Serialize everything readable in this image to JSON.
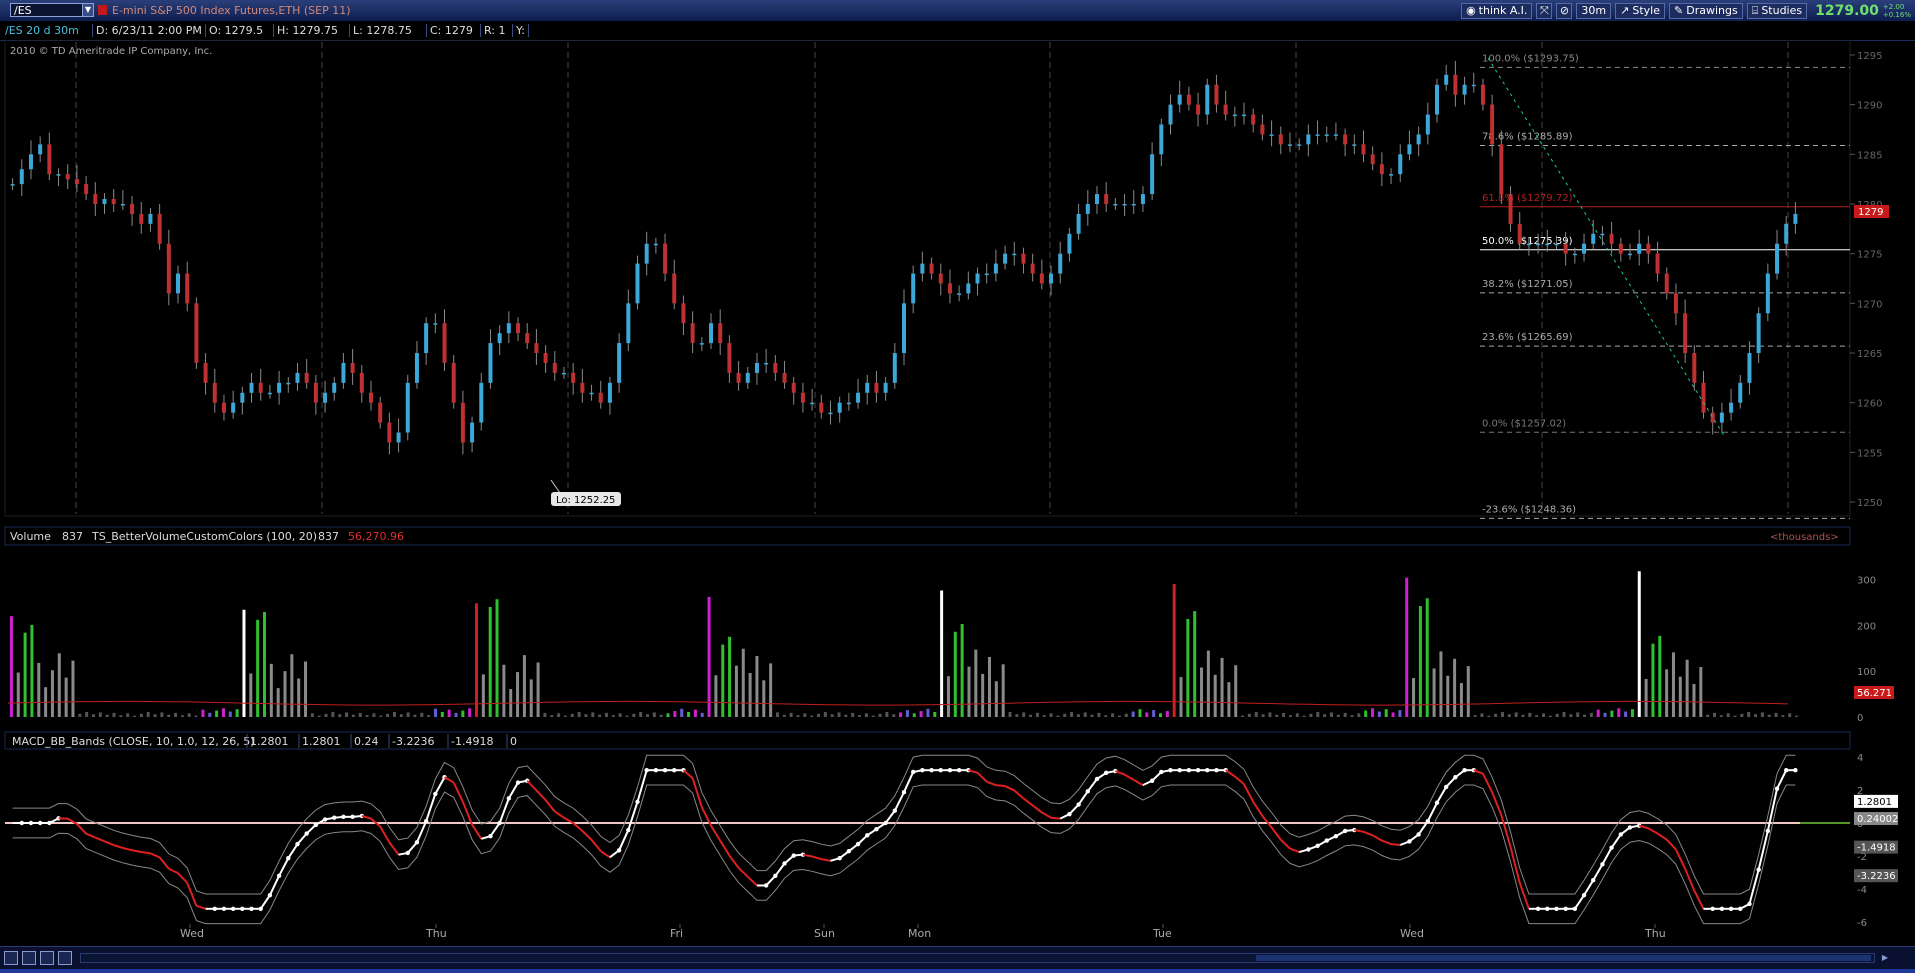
{
  "toolbar": {
    "symbol": "/ES",
    "description": "E-mini S&P 500 Index Futures,ETH (SEP 11)",
    "think_ai": "think A.I.",
    "timeframe": "30m",
    "style": "Style",
    "drawings": "Drawings",
    "studies": "Studies",
    "last_price": "1279.00",
    "change_abs": "+2.00",
    "change_pct": "+0.16%"
  },
  "infobar": {
    "chart_label": "/ES 20 d 30m",
    "date": "D: 6/23/11 2:00 PM",
    "open": "O: 1279.5",
    "high": "H: 1279.75",
    "low": "L: 1278.75",
    "close": "C: 1279",
    "range": "R: 1",
    "y": "Y:"
  },
  "copyright": "2010 © TD Ameritrade IP Company, Inc.",
  "price_pane": {
    "y_ticks": [
      "1295",
      "1290",
      "1285",
      "1280",
      "1275",
      "1270",
      "1265",
      "1260",
      "1255",
      "1250"
    ],
    "price_tag": "1279",
    "low_label": "Lo: 1252.25",
    "fib_levels": [
      {
        "label": "100.0% ($1293.75)",
        "price": 1293.75,
        "color": "#888888"
      },
      {
        "label": "78.6% ($1285.89)",
        "price": 1285.89,
        "color": "#aaaaaa"
      },
      {
        "label": "61.8% ($1279.72)",
        "price": 1279.72,
        "color": "#b02020"
      },
      {
        "label": "50.0% ($1275.39)",
        "price": 1275.39,
        "color": "#ffffff"
      },
      {
        "label": "38.2% ($1271.05)",
        "price": 1271.05,
        "color": "#aaaaaa"
      },
      {
        "label": "23.6% ($1265.69)",
        "price": 1265.69,
        "color": "#aaaaaa"
      },
      {
        "label": "0.0% ($1257.02)",
        "price": 1257.02,
        "color": "#777777"
      },
      {
        "label": "-23.6% ($1248.36)",
        "price": 1248.36,
        "color": "#aaaaaa"
      }
    ]
  },
  "volume_pane": {
    "label": "Volume",
    "value": "837",
    "study": "TS_BetterVolumeCustomColors (100, 20)",
    "study_value": "837",
    "avg_value": "56,270.96",
    "units": "<thousands>",
    "y_ticks": [
      "300",
      "200",
      "100",
      "0"
    ],
    "avg_tag": "56.271"
  },
  "macd_pane": {
    "study": "MACD_BB_Bands (CLOSE, 10, 1.0, 12, 26, 5)",
    "values": [
      "1.2801",
      "1.2801",
      "0.24",
      "-3.2236",
      "-1.4918",
      "0"
    ],
    "y_ticks": [
      "4",
      "2",
      "0",
      "-2",
      "-4",
      "-6"
    ],
    "tags": [
      "1.2801",
      "0.24002",
      "-1.4918",
      "-3.2236"
    ]
  },
  "x_axis": [
    "Wed",
    "Thu",
    "Fri",
    "Sun",
    "Mon",
    "Tue",
    "Wed",
    "Thu"
  ],
  "chart_data": {
    "type": "candlestick",
    "price_ylim": [
      1249,
      1296
    ],
    "price_series": [
      1282,
      1283.5,
      1285,
      1286,
      1283,
      1283,
      1282.5,
      1282,
      1281,
      1280,
      1280.5,
      1280,
      1280,
      1279,
      1278,
      1279,
      1276,
      1271,
      1273,
      1270,
      1264,
      1262,
      1260,
      1259,
      1260,
      1261,
      1262,
      1261,
      1261,
      1262,
      1262,
      1263,
      1262,
      1260,
      1261,
      1262,
      1264,
      1263,
      1261,
      1260,
      1258,
      1256,
      1257,
      1262,
      1265,
      1268,
      1268,
      1264,
      1260,
      1256,
      1258,
      1262,
      1266,
      1267,
      1268,
      1267,
      1266,
      1265,
      1264,
      1263,
      1263,
      1262,
      1261,
      1261,
      1260,
      1262,
      1266,
      1270,
      1274,
      1276,
      1276,
      1273,
      1270,
      1268,
      1266,
      1266,
      1268,
      1266,
      1263,
      1262,
      1263,
      1264,
      1264,
      1263,
      1262,
      1261,
      1260,
      1260,
      1259,
      1259,
      1260,
      1260,
      1261,
      1262,
      1261,
      1262,
      1265,
      1270,
      1273,
      1274,
      1273,
      1272,
      1271,
      1271,
      1272,
      1273,
      1273,
      1274,
      1275,
      1275,
      1274,
      1273,
      1272,
      1273,
      1275,
      1277,
      1279,
      1280,
      1281,
      1280,
      1280,
      1280,
      1280,
      1281,
      1285,
      1288,
      1290,
      1291,
      1290,
      1289,
      1292,
      1290,
      1289,
      1289,
      1289,
      1288,
      1287,
      1287,
      1286,
      1286,
      1286,
      1287,
      1287,
      1287,
      1287,
      1286,
      1286,
      1285,
      1284,
      1283,
      1283,
      1285,
      1286,
      1287,
      1289,
      1292,
      1293,
      1291,
      1292,
      1292,
      1290,
      1286,
      1281,
      1278,
      1276,
      1276,
      1276,
      1276,
      1276,
      1275,
      1275,
      1276,
      1277,
      1277,
      1276,
      1275,
      1275,
      1276,
      1275,
      1273,
      1271,
      1269,
      1265,
      1262,
      1259,
      1258,
      1259,
      1260,
      1262,
      1265,
      1269,
      1273,
      1276,
      1278,
      1279
    ],
    "volume_ylim": [
      0,
      360
    ],
    "macd_ylim": [
      -6,
      4
    ]
  }
}
